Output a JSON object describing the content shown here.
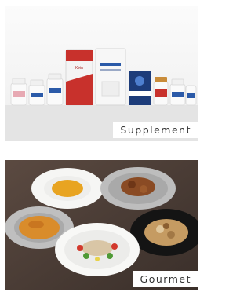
{
  "tiles": [
    {
      "id": "supplement",
      "label": "Supplement"
    },
    {
      "id": "gourmet",
      "label": "Gourmet"
    }
  ],
  "colors": {
    "accent_red": "#c8312c",
    "blue_label": "#2b5aa8",
    "table_wood": "#4a3c35"
  },
  "products": {
    "pouch_front_label": "Kirin"
  }
}
